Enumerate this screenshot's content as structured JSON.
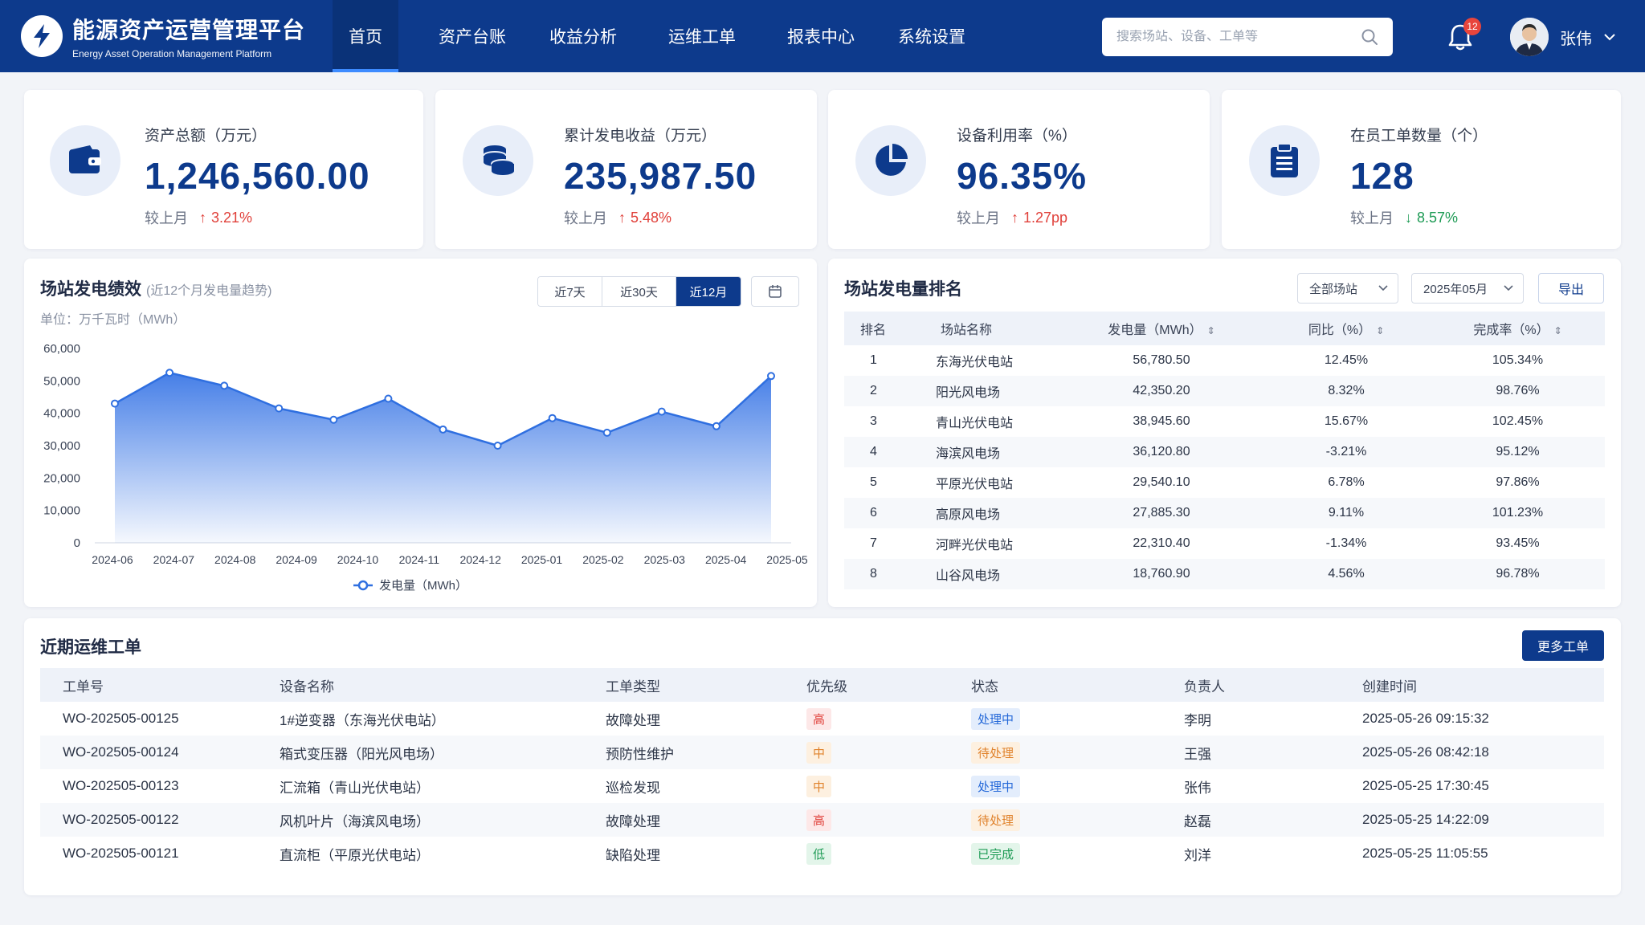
{
  "header": {
    "brand_title": "能源资产运营管理平台",
    "brand_subtitle": "Energy Asset Operation Management Platform",
    "nav": [
      {
        "label": "首页",
        "active": true
      },
      {
        "label": "资产台账",
        "active": false
      },
      {
        "label": "收益分析",
        "active": false
      },
      {
        "label": "运维工单",
        "active": false
      },
      {
        "label": "报表中心",
        "active": false
      },
      {
        "label": "系统设置",
        "active": false
      }
    ],
    "search_placeholder": "搜索场站、设备、工单等",
    "notification_count": "12",
    "user_name": "张伟"
  },
  "stats": [
    {
      "icon": "wallet-icon",
      "label": "资产总额（万元）",
      "value": "1,246,560.00",
      "compare_label": "较上月",
      "trend": "up",
      "change": "3.21%"
    },
    {
      "icon": "coins-icon",
      "label": "累计发电收益（万元）",
      "value": "235,987.50",
      "compare_label": "较上月",
      "trend": "up",
      "change": "5.48%"
    },
    {
      "icon": "pie-chart-icon",
      "label": "设备利用率（%）",
      "value": "96.35%",
      "compare_label": "较上月",
      "trend": "up",
      "change": "1.27pp"
    },
    {
      "icon": "clipboard-icon",
      "label": "在员工单数量（个）",
      "value": "128",
      "compare_label": "较上月",
      "trend": "down",
      "change": "8.57%"
    }
  ],
  "performance": {
    "title": "场站发电绩效",
    "subtitle": "(近12个月发电量趋势)",
    "unit": "单位：万千瓦时（MWh）",
    "ranges": [
      {
        "label": "近7天",
        "active": false
      },
      {
        "label": "近30天",
        "active": false
      },
      {
        "label": "近12月",
        "active": true
      }
    ]
  },
  "chart_data": {
    "type": "area",
    "x": [
      "2024-06",
      "2024-07",
      "2024-08",
      "2024-09",
      "2024-10",
      "2024-11",
      "2024-12",
      "2025-01",
      "2025-02",
      "2025-03",
      "2025-04",
      "2025-05"
    ],
    "series": [
      {
        "name": "发电量（MWh）",
        "values": [
          43000,
          52500,
          48500,
          41500,
          38000,
          44500,
          35000,
          30000,
          38500,
          34000,
          40500,
          36000,
          51500
        ]
      }
    ],
    "ylim": [
      0,
      60000
    ],
    "yticks": [
      "60,000",
      "50,000",
      "40,000",
      "30,000",
      "20,000",
      "10,000",
      "0"
    ],
    "grid": true,
    "legend": "bottom",
    "color": "#2f6fe0"
  },
  "ranking": {
    "title": "场站发电量排名",
    "filter_station": "全部场站",
    "filter_month": "2025年05月",
    "export_label": "导出",
    "columns": [
      "排名",
      "场站名称",
      "发电量（MWh）",
      "同比（%）",
      "完成率（%）"
    ],
    "rows": [
      {
        "rank": "1",
        "name": "东海光伏电站",
        "output": "56,780.50",
        "yoy": "12.45%",
        "neg": false,
        "rate": "105.34%"
      },
      {
        "rank": "2",
        "name": "阳光风电场",
        "output": "42,350.20",
        "yoy": "8.32%",
        "neg": false,
        "rate": "98.76%"
      },
      {
        "rank": "3",
        "name": "青山光伏电站",
        "output": "38,945.60",
        "yoy": "15.67%",
        "neg": false,
        "rate": "102.45%"
      },
      {
        "rank": "4",
        "name": "海滨风电场",
        "output": "36,120.80",
        "yoy": "-3.21%",
        "neg": true,
        "rate": "95.12%"
      },
      {
        "rank": "5",
        "name": "平原光伏电站",
        "output": "29,540.10",
        "yoy": "6.78%",
        "neg": false,
        "rate": "97.86%"
      },
      {
        "rank": "6",
        "name": "高原风电场",
        "output": "27,885.30",
        "yoy": "9.11%",
        "neg": false,
        "rate": "101.23%"
      },
      {
        "rank": "7",
        "name": "河畔光伏电站",
        "output": "22,310.40",
        "yoy": "-1.34%",
        "neg": true,
        "rate": "93.45%"
      },
      {
        "rank": "8",
        "name": "山谷风电场",
        "output": "18,760.90",
        "yoy": "4.56%",
        "neg": false,
        "rate": "96.78%"
      }
    ]
  },
  "workorders": {
    "title": "近期运维工单",
    "more_label": "更多工单",
    "columns": [
      "工单号",
      "设备名称",
      "工单类型",
      "优先级",
      "状态",
      "负责人",
      "创建时间"
    ],
    "rows": [
      {
        "id": "WO-202505-00125",
        "device": "1#逆变器（东海光伏电站）",
        "type": "故障处理",
        "priority": "高",
        "pclass": "p-high",
        "status": "处理中",
        "sclass": "s-proc",
        "owner": "李明",
        "time": "2025-05-26 09:15:32"
      },
      {
        "id": "WO-202505-00124",
        "device": "箱式变压器（阳光风电场）",
        "type": "预防性维护",
        "priority": "中",
        "pclass": "p-mid",
        "status": "待处理",
        "sclass": "s-wait",
        "owner": "王强",
        "time": "2025-05-26 08:42:18"
      },
      {
        "id": "WO-202505-00123",
        "device": "汇流箱（青山光伏电站）",
        "type": "巡检发现",
        "priority": "中",
        "pclass": "p-mid",
        "status": "处理中",
        "sclass": "s-proc",
        "owner": "张伟",
        "time": "2025-05-25 17:30:45"
      },
      {
        "id": "WO-202505-00122",
        "device": "风机叶片（海滨风电场）",
        "type": "故障处理",
        "priority": "高",
        "pclass": "p-high",
        "status": "待处理",
        "sclass": "s-wait",
        "owner": "赵磊",
        "time": "2025-05-25 14:22:09"
      },
      {
        "id": "WO-202505-00121",
        "device": "直流柜（平原光伏电站）",
        "type": "缺陷处理",
        "priority": "低",
        "pclass": "p-low",
        "status": "已完成",
        "sclass": "s-done",
        "owner": "刘洋",
        "time": "2025-05-25 11:05:55"
      }
    ]
  }
}
